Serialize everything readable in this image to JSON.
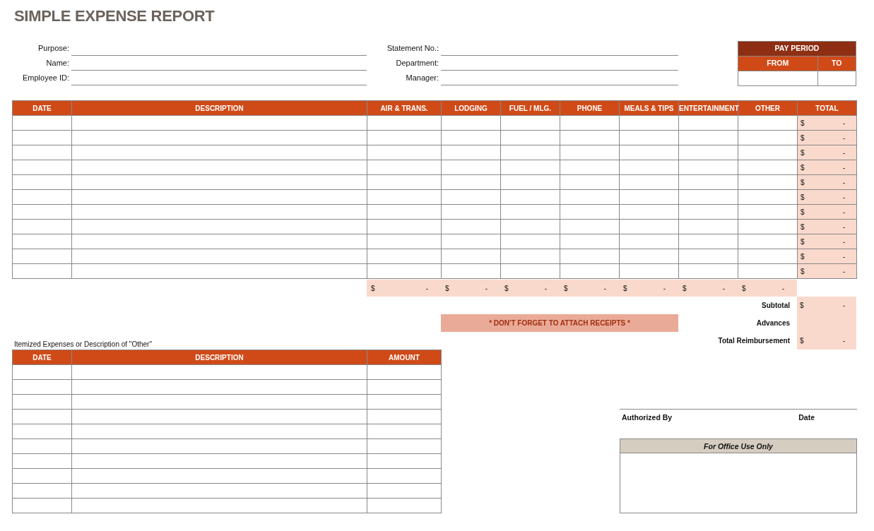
{
  "title": "SIMPLE EXPENSE REPORT",
  "header_fields": {
    "left": [
      {
        "label": "Purpose:"
      },
      {
        "label": "Name:"
      },
      {
        "label": "Employee ID:"
      }
    ],
    "right": [
      {
        "label": "Statement No.:"
      },
      {
        "label": "Department:"
      },
      {
        "label": "Manager:"
      }
    ]
  },
  "pay_period": {
    "title": "PAY PERIOD",
    "columns": [
      "FROM",
      "TO"
    ]
  },
  "expenses": {
    "columns": [
      "DATE",
      "DESCRIPTION",
      "AIR & TRANS.",
      "LODGING",
      "FUEL / MLG.",
      "PHONE",
      "MEALS & TIPS",
      "ENTERTAINMENT",
      "OTHER",
      "TOTAL"
    ],
    "rows": [
      {
        "total": {
          "currency": "$",
          "amount": "-"
        }
      },
      {
        "total": {
          "currency": "$",
          "amount": "-"
        }
      },
      {
        "total": {
          "currency": "$",
          "amount": "-"
        }
      },
      {
        "total": {
          "currency": "$",
          "amount": "-"
        }
      },
      {
        "total": {
          "currency": "$",
          "amount": "-"
        }
      },
      {
        "total": {
          "currency": "$",
          "amount": "-"
        }
      },
      {
        "total": {
          "currency": "$",
          "amount": "-"
        }
      },
      {
        "total": {
          "currency": "$",
          "amount": "-"
        }
      },
      {
        "total": {
          "currency": "$",
          "amount": "-"
        }
      },
      {
        "total": {
          "currency": "$",
          "amount": "-"
        }
      },
      {
        "total": {
          "currency": "$",
          "amount": "-"
        }
      }
    ],
    "column_totals": [
      {
        "currency": "$",
        "amount": "-"
      },
      {
        "currency": "$",
        "amount": "-"
      },
      {
        "currency": "$",
        "amount": "-"
      },
      {
        "currency": "$",
        "amount": "-"
      },
      {
        "currency": "$",
        "amount": "-"
      },
      {
        "currency": "$",
        "amount": "-"
      },
      {
        "currency": "$",
        "amount": "-"
      }
    ]
  },
  "summary": [
    {
      "label": "Subtotal",
      "currency": "$",
      "amount": "-"
    },
    {
      "label": "Advances"
    },
    {
      "label": "Total Reimbursement",
      "currency": "$",
      "amount": "-"
    }
  ],
  "reminder": "* DON'T FORGET TO ATTACH RECEIPTS *",
  "itemized": {
    "caption": "Itemized Expenses or Description of \"Other\"",
    "columns": [
      "DATE",
      "DESCRIPTION",
      "AMOUNT"
    ]
  },
  "signature": {
    "authorized_by": "Authorized By",
    "date": "Date"
  },
  "office_use": {
    "title": "For Office Use Only"
  }
}
